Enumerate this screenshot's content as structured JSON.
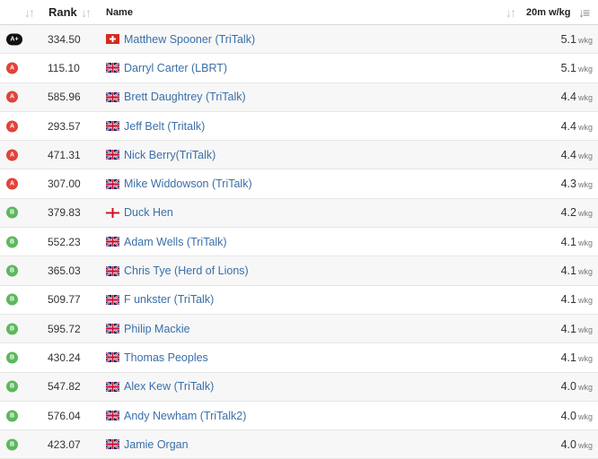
{
  "header": {
    "rank": "Rank",
    "name": "Name",
    "wkg": "20m w/kg"
  },
  "category_colors": {
    "A+": "#111111",
    "A": "#e0443a",
    "B": "#5cb85c"
  },
  "rows": [
    {
      "cat": "A+",
      "points": "334.50",
      "flag": "ch",
      "name": "Matthew Spooner (TriTalk)",
      "wkg": "5.1",
      "unit": "wkg"
    },
    {
      "cat": "A",
      "points": "115.10",
      "flag": "gb",
      "name": "Darryl Carter (LBRT)",
      "wkg": "5.1",
      "unit": "wkg"
    },
    {
      "cat": "A",
      "points": "585.96",
      "flag": "gb",
      "name": "Brett Daughtrey (TriTalk)",
      "wkg": "4.4",
      "unit": "wkg"
    },
    {
      "cat": "A",
      "points": "293.57",
      "flag": "gb",
      "name": "Jeff Belt (Tritalk)",
      "wkg": "4.4",
      "unit": "wkg"
    },
    {
      "cat": "A",
      "points": "471.31",
      "flag": "gb",
      "name": "Nick Berry(TriTalk)",
      "wkg": "4.4",
      "unit": "wkg"
    },
    {
      "cat": "A",
      "points": "307.00",
      "flag": "gb",
      "name": "Mike Widdowson (TriTalk)",
      "wkg": "4.3",
      "unit": "wkg"
    },
    {
      "cat": "B",
      "points": "379.83",
      "flag": "en",
      "name": "Duck Hen",
      "wkg": "4.2",
      "unit": "wkg"
    },
    {
      "cat": "B",
      "points": "552.23",
      "flag": "gb",
      "name": "Adam Wells (TriTalk)",
      "wkg": "4.1",
      "unit": "wkg"
    },
    {
      "cat": "B",
      "points": "365.03",
      "flag": "gb",
      "name": "Chris Tye (Herd of Lions)",
      "wkg": "4.1",
      "unit": "wkg"
    },
    {
      "cat": "B",
      "points": "509.77",
      "flag": "gb",
      "name": "F unkster (TriTalk)",
      "wkg": "4.1",
      "unit": "wkg"
    },
    {
      "cat": "B",
      "points": "595.72",
      "flag": "gb",
      "name": "Philip Mackie",
      "wkg": "4.1",
      "unit": "wkg"
    },
    {
      "cat": "B",
      "points": "430.24",
      "flag": "gb",
      "name": "Thomas Peoples",
      "wkg": "4.1",
      "unit": "wkg"
    },
    {
      "cat": "B",
      "points": "547.82",
      "flag": "gb",
      "name": "Alex Kew (TriTalk)",
      "wkg": "4.0",
      "unit": "wkg"
    },
    {
      "cat": "B",
      "points": "576.04",
      "flag": "gb",
      "name": "Andy Newham (TriTalk2)",
      "wkg": "4.0",
      "unit": "wkg"
    },
    {
      "cat": "B",
      "points": "423.07",
      "flag": "gb",
      "name": "Jamie Organ",
      "wkg": "4.0",
      "unit": "wkg"
    }
  ]
}
